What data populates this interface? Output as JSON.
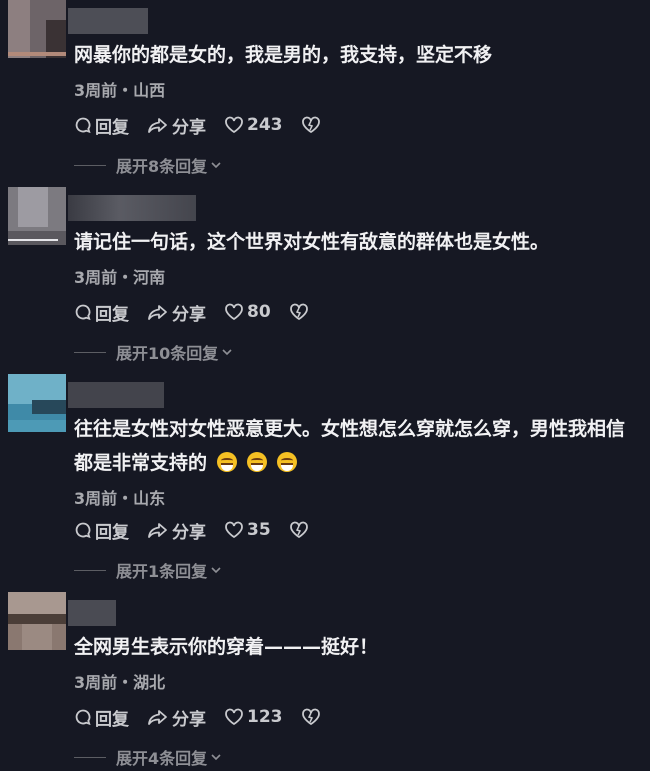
{
  "comments": [
    {
      "text": "网暴你的都是女的，我是男的，我支持，坚定不移",
      "meta": "3周前・山西",
      "reply_label": "回复",
      "share_label": "分享",
      "likes": "243",
      "expand_label": "展开8条回复",
      "avatar_colors": [
        "#6d6468",
        "#8d7f80",
        "#3a3234"
      ]
    },
    {
      "text": "请记住一句话，这个世界对女性有敌意的群体也是女性。",
      "meta": "3周前・河南",
      "reply_label": "回复",
      "share_label": "分享",
      "likes": "80",
      "expand_label": "展开10条回复",
      "avatar_colors": [
        "#7c7a80",
        "#9d9ba2",
        "#5a585e"
      ]
    },
    {
      "text": "往往是女性对女性恶意更大。女性想怎么穿就怎么穿，男性我相信都是非常支持的",
      "meta": "3周前・山东",
      "reply_label": "回复",
      "share_label": "分享",
      "likes": "35",
      "expand_label": "展开1条回复",
      "avatar_colors": [
        "#3f8aa8",
        "#6fb1c8",
        "#27485a"
      ]
    },
    {
      "text": "全网男生表示你的穿着———挺好！",
      "meta": "3周前・湖北",
      "reply_label": "回复",
      "share_label": "分享",
      "likes": "123",
      "expand_label": "展开4条回复",
      "avatar_colors": [
        "#8a7870",
        "#a89890",
        "#4b3e38"
      ]
    }
  ]
}
